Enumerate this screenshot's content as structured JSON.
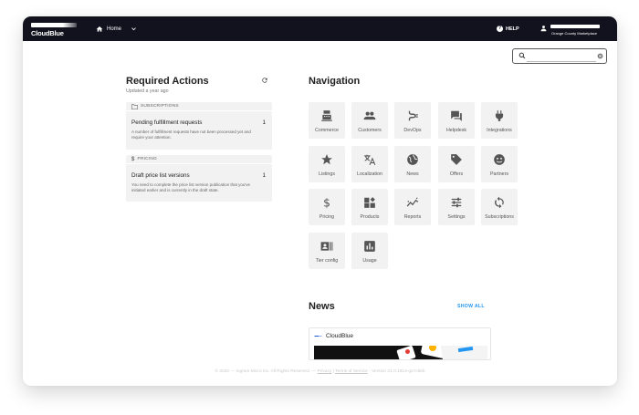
{
  "topbar": {
    "brand": "CloudBlue",
    "home_label": "Home",
    "help_label": "HELP",
    "org_name": "Orange County Marketplace"
  },
  "search": {
    "placeholder": "",
    "value": ""
  },
  "required_actions": {
    "title": "Required Actions",
    "updated": "Updated a year ago",
    "cards": [
      {
        "category": "SUBSCRIPTIONS",
        "icon": "folder-icon",
        "title": "Pending fulfillment requests",
        "count": "1",
        "description": "A number of fulfillment requests have not been processed yet and require your attention."
      },
      {
        "category": "PRICING",
        "icon": "dollar-icon",
        "title": "Draft price list versions",
        "count": "1",
        "description": "You need to complete the price list version publication that you've initiated earlier and is currently in the draft state."
      }
    ]
  },
  "navigation": {
    "title": "Navigation",
    "tiles": [
      {
        "label": "Commerce",
        "icon": "register-icon"
      },
      {
        "label": "Customers",
        "icon": "people-icon"
      },
      {
        "label": "DevOps",
        "icon": "devops-icon"
      },
      {
        "label": "Helpdesk",
        "icon": "chat-icon"
      },
      {
        "label": "Integrations",
        "icon": "plug-icon"
      },
      {
        "label": "Listings",
        "icon": "star-icon"
      },
      {
        "label": "Localization",
        "icon": "translate-icon"
      },
      {
        "label": "News",
        "icon": "globe-icon"
      },
      {
        "label": "Offers",
        "icon": "tag-icon"
      },
      {
        "label": "Partners",
        "icon": "handshake-icon"
      },
      {
        "label": "Pricing",
        "icon": "dollar-icon"
      },
      {
        "label": "Products",
        "icon": "products-icon"
      },
      {
        "label": "Reports",
        "icon": "chart-icon"
      },
      {
        "label": "Settings",
        "icon": "sliders-icon"
      },
      {
        "label": "Subscriptions",
        "icon": "sync-icon"
      },
      {
        "label": "Tier config",
        "icon": "id-card-icon"
      },
      {
        "label": "Usage",
        "icon": "bar-chart-icon"
      }
    ]
  },
  "news": {
    "title": "News",
    "show_all": "SHOW ALL",
    "card_source": "CloudBlue"
  },
  "footer": {
    "copyright": "© 2020 — Ingram Micro Inc. All Rights Reserved. — ",
    "privacy": "Privacy",
    "sep": " | ",
    "terms": "Terms of Service",
    "version": " - Version 21.0.1913-gs7c8eb"
  },
  "colors": {
    "topbar": "#12121e",
    "accent": "#2196f3",
    "tile_bg": "#f2f2f2"
  }
}
